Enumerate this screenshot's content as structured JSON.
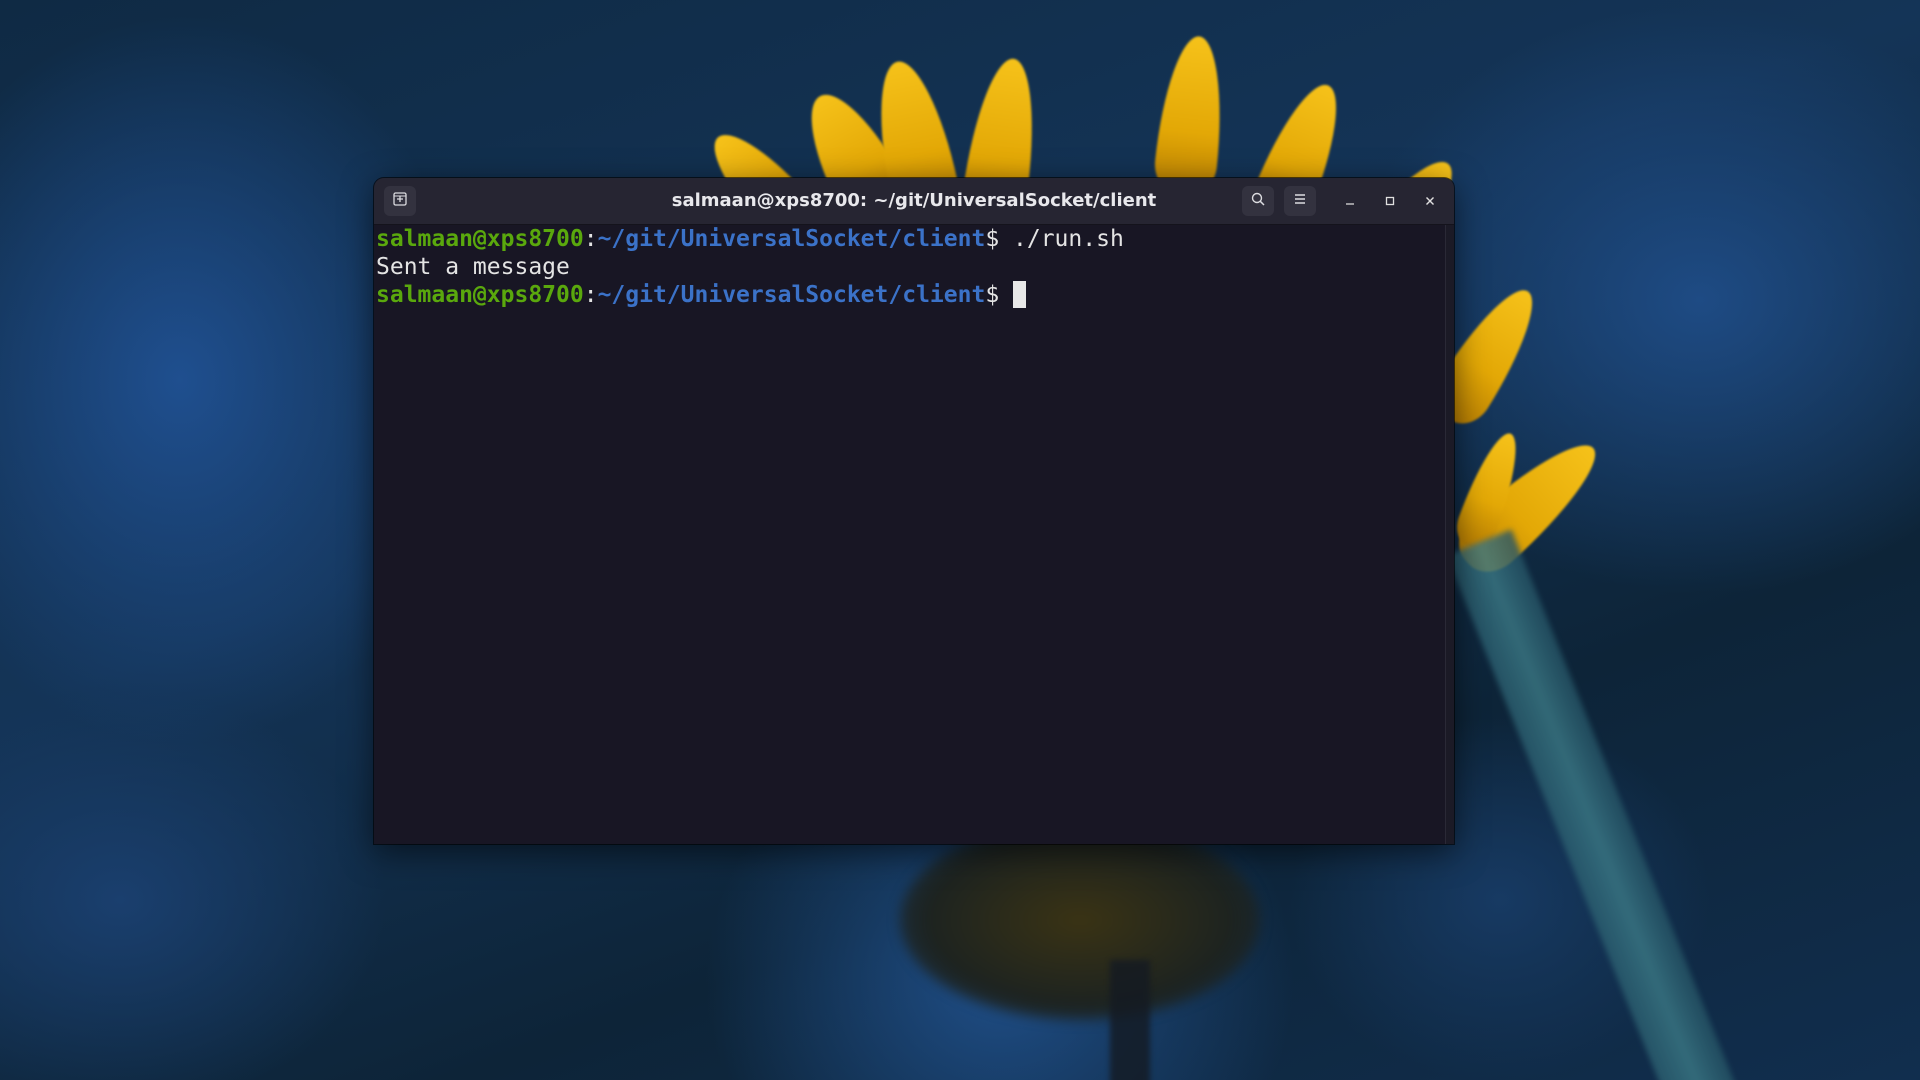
{
  "window": {
    "title": "salmaan@xps8700: ~/git/UniversalSocket/client"
  },
  "icons": {
    "new_tab": "new-tab-icon",
    "search": "search-icon",
    "menu": "hamburger-menu-icon",
    "minimize": "minimize-icon",
    "maximize": "maximize-icon",
    "close": "close-icon"
  },
  "terminal": {
    "lines": [
      {
        "user_host": "salmaan@xps8700",
        "separator": ":",
        "path": "~/git/UniversalSocket/client",
        "prompt_symbol": "$",
        "command": " ./run.sh"
      },
      {
        "output": "Sent a message"
      },
      {
        "user_host": "salmaan@xps8700",
        "separator": ":",
        "path": "~/git/UniversalSocket/client",
        "prompt_symbol": "$",
        "command": ""
      }
    ]
  },
  "colors": {
    "prompt_user": "#5aa80d",
    "prompt_path": "#3b72c8",
    "terminal_bg": "#181624",
    "titlebar_bg": "#262532"
  }
}
